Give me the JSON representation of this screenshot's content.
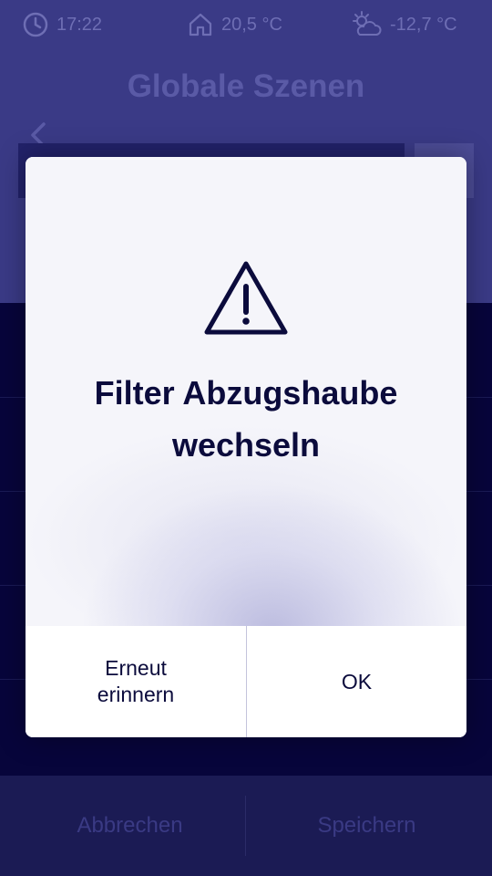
{
  "statusbar": {
    "time": "17:22",
    "indoor_temp": "20,5 °C",
    "outdoor_temp": "-12,7 °C"
  },
  "header": {
    "title": "Globale Szenen"
  },
  "list": {
    "items": [
      {
        "label": ""
      },
      {
        "label": ""
      },
      {
        "label": ""
      },
      {
        "label": ""
      },
      {
        "label": ""
      }
    ]
  },
  "footer": {
    "cancel_label": "Abbrechen",
    "save_label": "Speichern"
  },
  "dialog": {
    "icon": "warning-triangle-icon",
    "message_line1": "Filter Abzugshaube",
    "message_line2": "wechseln",
    "remind_line1": "Erneut",
    "remind_line2": "erinnern",
    "ok_label": "OK"
  },
  "colors": {
    "header_bg": "#3a3a86",
    "app_bg": "#06053a",
    "dialog_text": "#0b0b3c"
  }
}
